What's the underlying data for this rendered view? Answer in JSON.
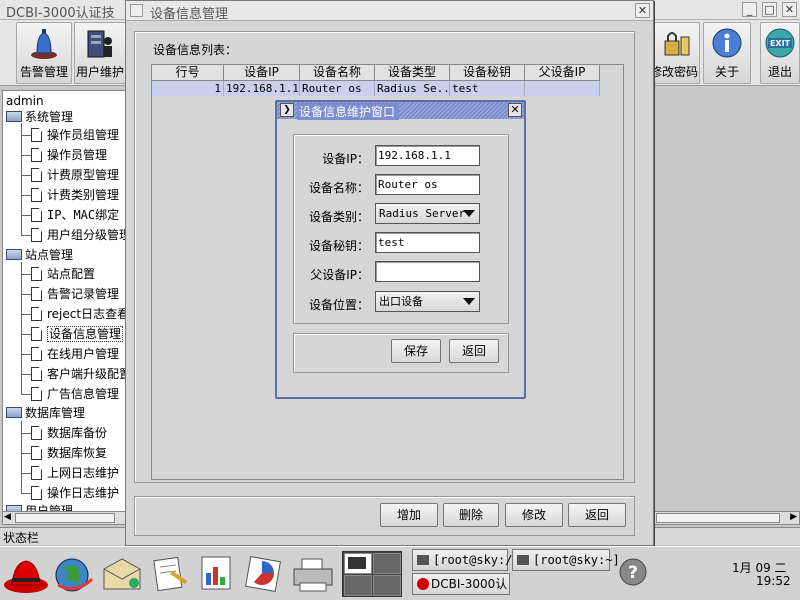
{
  "main_window": {
    "title": "DCBI-3000认证技",
    "toolbar": {
      "left": [
        {
          "label": "告警管理",
          "icon": "alarm-bell-icon"
        },
        {
          "label": "用户维护",
          "icon": "user-maintenance-icon"
        }
      ],
      "right": [
        {
          "label": "修改密码",
          "icon": "lock-key-icon"
        },
        {
          "label": "关于",
          "icon": "info-icon"
        },
        {
          "label": "退出",
          "icon": "exit-icon",
          "badge": "EXIT"
        }
      ]
    },
    "tree": {
      "root": "admin",
      "groups": [
        {
          "label": "系统管理",
          "items": [
            "操作员组管理",
            "操作员管理",
            "计费原型管理",
            "计费类别管理",
            "IP、MAC绑定",
            "用户组分级管理"
          ]
        },
        {
          "label": "站点管理",
          "items": [
            "站点配置",
            "告警记录管理",
            "reject日志查看",
            "设备信息管理",
            "在线用户管理",
            "客户端升级配置",
            "广告信息管理"
          ]
        },
        {
          "label": "数据库管理",
          "items": [
            "数据库备份",
            "数据库恢复",
            "上网日志维护",
            "操作日志维护"
          ]
        },
        {
          "label": "用户管理",
          "items": []
        }
      ]
    },
    "status_label": "状态栏"
  },
  "device_window": {
    "title": "设备信息管理",
    "list_label": "设备信息列表：",
    "columns": [
      "行号",
      "设备IP",
      "设备名称",
      "设备类型",
      "设备秘钥",
      "父设备IP"
    ],
    "rows": [
      {
        "row_no": "1",
        "ip": "192.168.1.1",
        "name": "Router os",
        "type": "Radius Se...",
        "secret": "test",
        "parent_ip": ""
      }
    ],
    "buttons": {
      "add": "增加",
      "delete": "删除",
      "modify": "修改",
      "back": "返回"
    }
  },
  "dialog": {
    "title": "设备信息维护窗口",
    "fields": {
      "ip_label": "设备IP：",
      "ip_value": "192.168.1.1",
      "name_label": "设备名称：",
      "name_value": "Router os",
      "type_label": "设备类别：",
      "type_value": "Radius Server",
      "secret_label": "设备秘钥：",
      "secret_value": "test",
      "parent_label": "父设备IP：",
      "parent_value": "",
      "location_label": "设备位置：",
      "location_value": "出口设备"
    },
    "buttons": {
      "save": "保存",
      "back": "返回"
    }
  },
  "taskbar": {
    "tasks": [
      "[root@sky:/]",
      "[root@sky:~]",
      "DCBI-3000认"
    ],
    "clock": {
      "date": "1月 09 二",
      "time": "19:52"
    },
    "help": "?"
  },
  "colors": {
    "selection": "#c8d0ee",
    "dialog_title": "#7c8dd0",
    "background": "#c8c8c8"
  }
}
